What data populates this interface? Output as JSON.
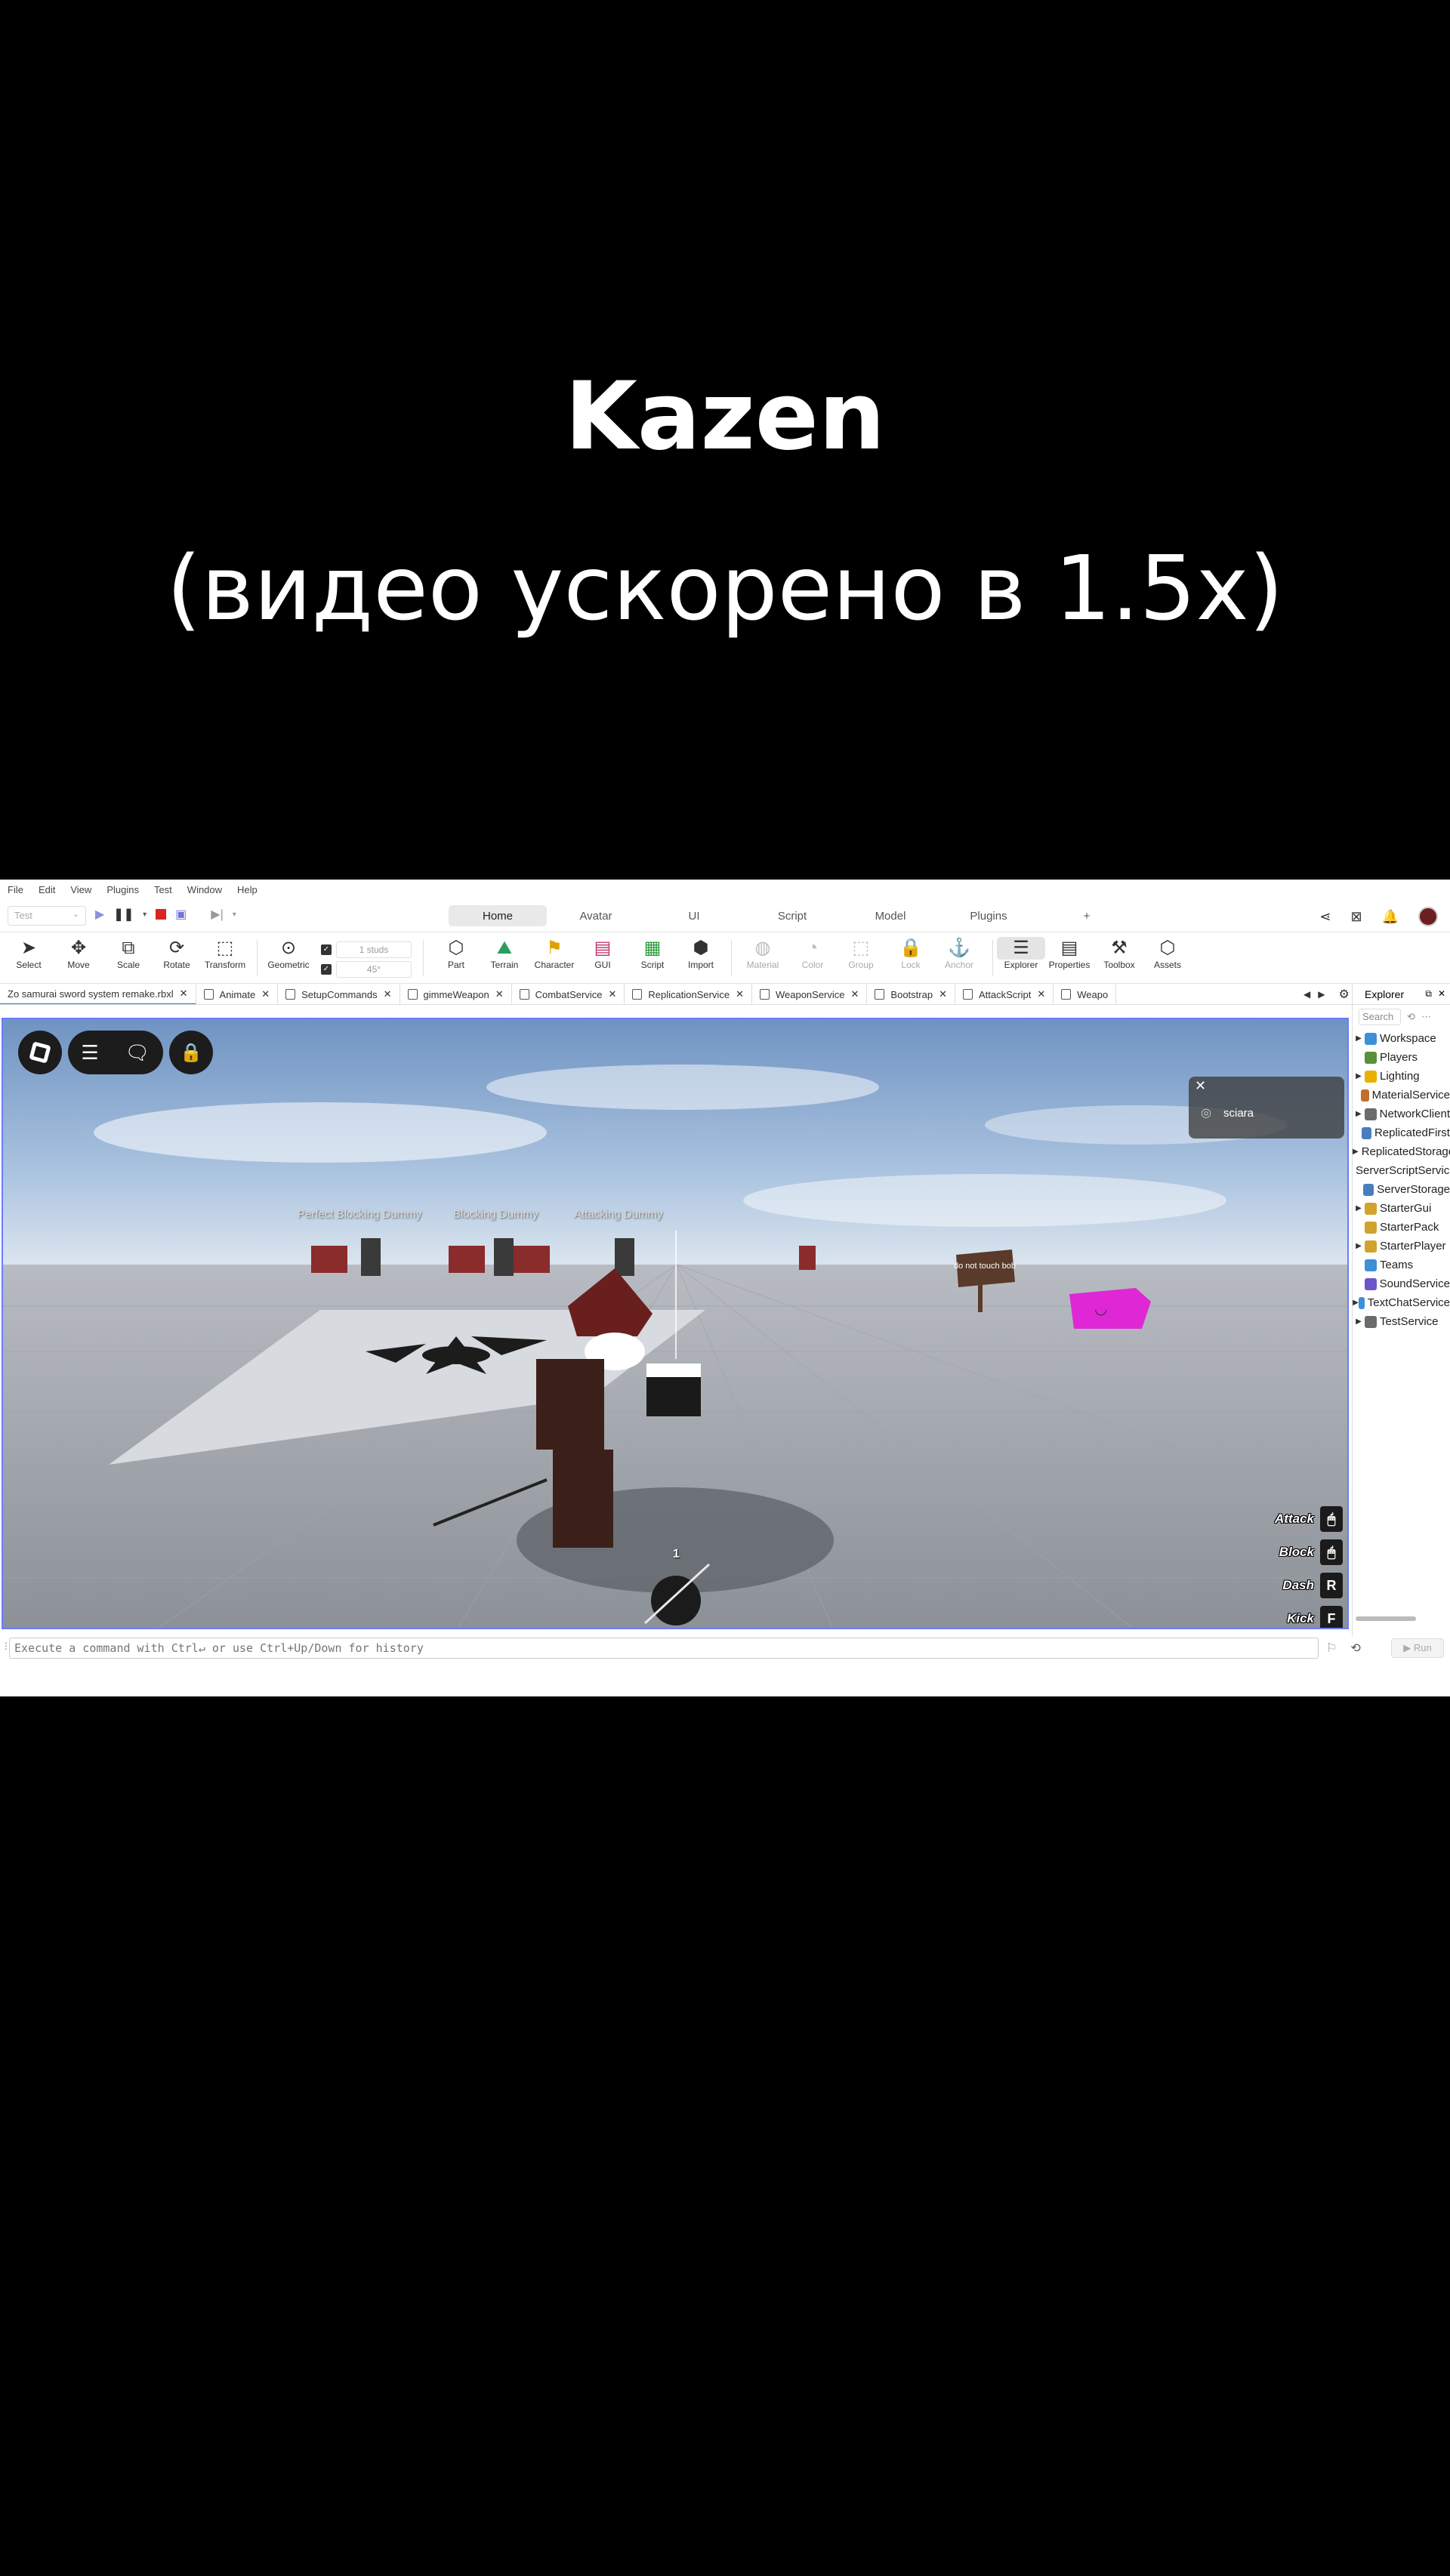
{
  "caption": {
    "title": "Kazen",
    "subtitle": "(видео ускорено в 1.5x)"
  },
  "menubar": [
    "File",
    "Edit",
    "View",
    "Plugins",
    "Test",
    "Window",
    "Help"
  ],
  "test_select": "Test",
  "ribbon_tabs": [
    {
      "label": "Home",
      "active": true
    },
    {
      "label": "Avatar"
    },
    {
      "label": "UI"
    },
    {
      "label": "Script"
    },
    {
      "label": "Model"
    },
    {
      "label": "Plugins"
    },
    {
      "label": "+"
    }
  ],
  "tools": {
    "select": "Select",
    "move": "Move",
    "scale": "Scale",
    "rotate": "Rotate",
    "transform": "Transform",
    "geometric": "Geometric",
    "part": "Part",
    "terrain": "Terrain",
    "character": "Character",
    "gui": "GUI",
    "script": "Script",
    "import": "Import",
    "material": "Material",
    "color": "Color",
    "group": "Group",
    "lock": "Lock",
    "anchor": "Anchor",
    "explorer": "Explorer",
    "properties": "Properties",
    "toolbox": "Toolbox",
    "assets": "Assets"
  },
  "snap": {
    "move_increment": "1 studs",
    "rotate_increment": "45°"
  },
  "file_tabs": [
    {
      "label": "Zo samurai sword system remake.rbxl",
      "active": true
    },
    {
      "label": "Animate"
    },
    {
      "label": "SetupCommands"
    },
    {
      "label": "gimmeWeapon"
    },
    {
      "label": "CombatService"
    },
    {
      "label": "ReplicationService"
    },
    {
      "label": "WeaponService"
    },
    {
      "label": "Bootstrap"
    },
    {
      "label": "AttackScript"
    },
    {
      "label": "Weapo"
    }
  ],
  "viewport": {
    "chat_user": "sciara",
    "npc_labels": {
      "perfect_blocking": "Perfect Blocking Dummy",
      "blocking": "Blocking Dummy",
      "attacking": "Attacking Dummy"
    },
    "sign_text": "do not touch bob",
    "hotbar_slot": "1",
    "hotkeys": [
      {
        "label": "Attack",
        "key": "🖱"
      },
      {
        "label": "Block",
        "key": "🖱"
      },
      {
        "label": "Dash",
        "key": "R"
      },
      {
        "label": "Kick",
        "key": "F"
      }
    ]
  },
  "explorer": {
    "title": "Explorer",
    "search_placeholder": "Search",
    "items": [
      {
        "label": "Workspace",
        "expandable": true,
        "color": "#3d8fd8"
      },
      {
        "label": "Players",
        "expandable": false,
        "color": "#5a8f3c"
      },
      {
        "label": "Lighting",
        "expandable": true,
        "color": "#e8b000"
      },
      {
        "label": "MaterialService",
        "expandable": false,
        "color": "#c26e2b"
      },
      {
        "label": "NetworkClient",
        "expandable": true,
        "color": "#6b6b6b"
      },
      {
        "label": "ReplicatedFirst",
        "expandable": false,
        "color": "#4a7dbf"
      },
      {
        "label": "ReplicatedStorage",
        "expandable": true,
        "color": "#4a7dbf"
      },
      {
        "label": "ServerScriptService",
        "expandable": false,
        "color": "#3c9b50"
      },
      {
        "label": "ServerStorage",
        "expandable": false,
        "color": "#4a7dbf"
      },
      {
        "label": "StarterGui",
        "expandable": true,
        "color": "#d1a32d"
      },
      {
        "label": "StarterPack",
        "expandable": false,
        "color": "#d1a32d"
      },
      {
        "label": "StarterPlayer",
        "expandable": true,
        "color": "#d1a32d"
      },
      {
        "label": "Teams",
        "expandable": false,
        "color": "#3d8fd8"
      },
      {
        "label": "SoundService",
        "expandable": false,
        "color": "#6c55c9"
      },
      {
        "label": "TextChatService",
        "expandable": true,
        "color": "#3d8fd8"
      },
      {
        "label": "TestService",
        "expandable": true,
        "color": "#6b6b6b"
      }
    ]
  },
  "command_bar": {
    "placeholder": "Execute a command with Ctrl↵ or use Ctrl+Up/Down for history",
    "run_label": "▶ Run"
  }
}
